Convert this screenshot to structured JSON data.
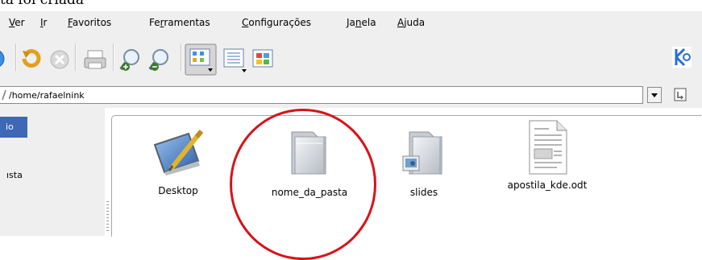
{
  "caption": "ta foi criada",
  "menu": {
    "items": [
      "Ver",
      "Ir",
      "Favoritos",
      "Ferramentas",
      "Configurações",
      "Janela",
      "Ajuda"
    ],
    "mnemonics": [
      "V",
      "I",
      "F",
      "r",
      "C",
      "n",
      "A"
    ]
  },
  "toolbar": {
    "buttons": [
      "home-icon",
      "reload-icon",
      "stop-icon",
      "print-icon",
      "zoom-in-icon",
      "zoom-out-icon",
      "icon-view-icon",
      "detail-view-icon",
      "tile-view-icon"
    ],
    "brand_icon": "kde-icon"
  },
  "location": {
    "path": "/home/rafaelnink"
  },
  "sidebar": {
    "selected_label": "io",
    "item_label": "ısta"
  },
  "files": [
    {
      "name": "Desktop",
      "icon": "desktop-folder-icon"
    },
    {
      "name": "nome_da_pasta",
      "icon": "folder-icon"
    },
    {
      "name": "slides",
      "icon": "image-folder-icon"
    },
    {
      "name": "apostila_kde.odt",
      "icon": "document-icon"
    }
  ],
  "annotation": {
    "color": "#d8121a",
    "highlighted_file": "nome_da_pasta"
  },
  "colors": {
    "selection": "#3e67b5",
    "chrome_bg": "#efefef"
  }
}
